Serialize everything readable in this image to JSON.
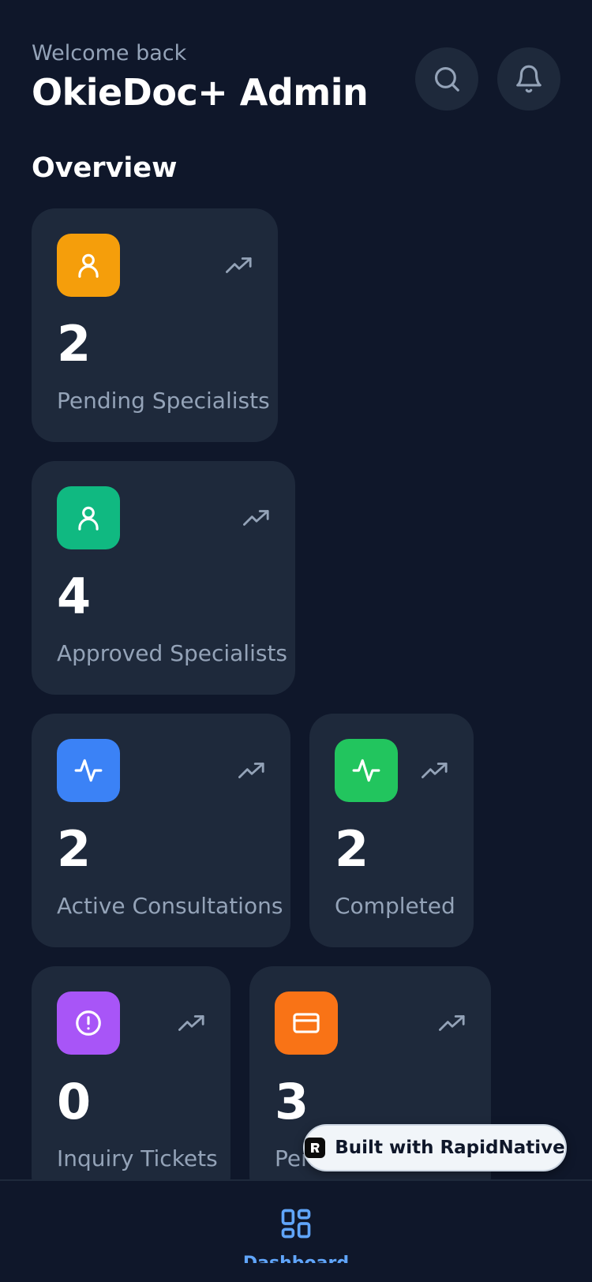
{
  "header": {
    "welcome": "Welcome back",
    "title": "OkieDoc+ Admin"
  },
  "overview": {
    "title": "Overview",
    "cards": [
      {
        "value": "2",
        "label": "Pending Specialists",
        "icon": "user-icon",
        "color": "#f59e0b"
      },
      {
        "value": "4",
        "label": "Approved Specialists",
        "icon": "user-icon",
        "color": "#10b981"
      },
      {
        "value": "2",
        "label": "Active Consultations",
        "icon": "activity-icon",
        "color": "#3b82f6"
      },
      {
        "value": "2",
        "label": "Completed",
        "icon": "activity-icon",
        "color": "#22c55e"
      },
      {
        "value": "0",
        "label": "Inquiry Tickets",
        "icon": "alert-circle-icon",
        "color": "#a855f7"
      },
      {
        "value": "3",
        "label": "Pending Payments",
        "icon": "credit-card-icon",
        "color": "#f97316"
      }
    ]
  },
  "badge": {
    "text": "Built with RapidNative"
  },
  "tabbar": {
    "dashboard_label": "Dashboard",
    "accent": "#60a5fa"
  }
}
